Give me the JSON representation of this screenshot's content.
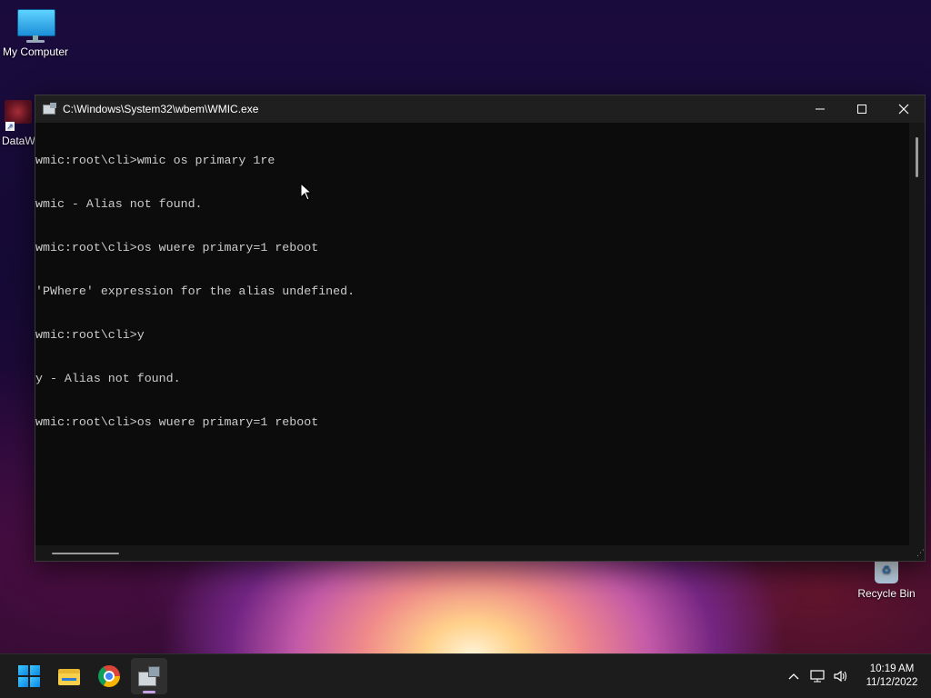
{
  "desktop": {
    "icons": [
      {
        "label": "My Computer"
      },
      {
        "label": "DataW"
      },
      {
        "label": "Recycle Bin"
      }
    ]
  },
  "window": {
    "title": "C:\\Windows\\System32\\wbem\\WMIC.exe",
    "controls": {
      "minimize": "—",
      "maximize": "☐",
      "close": "✕"
    },
    "console_lines": [
      "wmic:root\\cli>wmic os primary 1re",
      "wmic - Alias not found.",
      "wmic:root\\cli>os wuere primary=1 reboot",
      "'PWhere' expression for the alias undefined.",
      "wmic:root\\cli>y",
      "y - Alias not found.",
      "wmic:root\\cli>os wuere primary=1 reboot"
    ]
  },
  "taskbar": {
    "apps": [
      {
        "name": "start-icon"
      },
      {
        "name": "file-explorer-icon"
      },
      {
        "name": "chrome-icon"
      },
      {
        "name": "wmic-icon",
        "active": true
      }
    ],
    "tray": {
      "chevron": "^",
      "time": "10:19 AM",
      "date": "11/12/2022"
    }
  }
}
